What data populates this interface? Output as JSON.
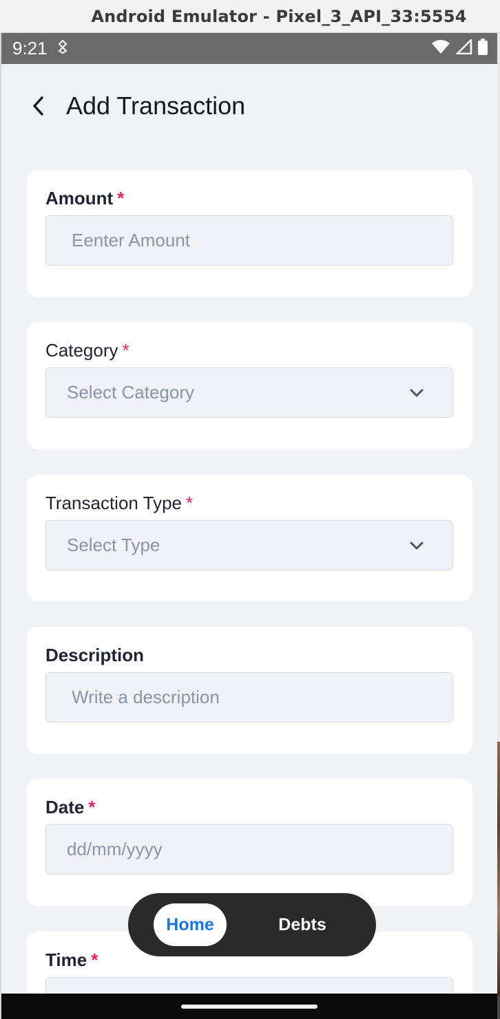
{
  "window": {
    "title": "Android Emulator - Pixel_3_API_33:5554"
  },
  "status_bar": {
    "time": "9:21"
  },
  "header": {
    "title": "Add Transaction"
  },
  "form": {
    "amount": {
      "label": "Amount",
      "required": "*",
      "placeholder": "Eenter Amount"
    },
    "category": {
      "label": "Category",
      "required": "*",
      "placeholder": "Select Category"
    },
    "transaction_type": {
      "label": "Transaction Type",
      "required": "*",
      "placeholder": "Select Type"
    },
    "description": {
      "label": "Description",
      "placeholder": "Write a description"
    },
    "date": {
      "label": "Date",
      "required": "*",
      "placeholder": "dd/mm/yyyy"
    },
    "time": {
      "label": "Time",
      "required": "*"
    }
  },
  "bottom_nav": {
    "items": [
      {
        "label": "Home",
        "active": true
      },
      {
        "label": "Debts",
        "active": false
      }
    ]
  },
  "colors": {
    "accent": "#1677e6",
    "required": "#e0245e",
    "background": "#f1f2f6",
    "nav_bg": "#2a2a2a"
  }
}
